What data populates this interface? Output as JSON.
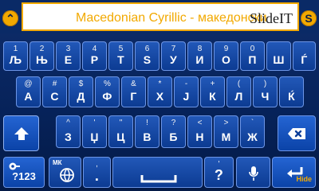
{
  "suggestion": {
    "text": "Macedonian Cyrillic - македонски",
    "brand": "SlideIT"
  },
  "side_buttons": {
    "left": "⌃",
    "right": "S"
  },
  "rows": {
    "row1": [
      {
        "alt": "1",
        "main": "Љ"
      },
      {
        "alt": "2",
        "main": "Њ"
      },
      {
        "alt": "3",
        "main": "Е"
      },
      {
        "alt": "4",
        "main": "Р"
      },
      {
        "alt": "5",
        "main": "Т"
      },
      {
        "alt": "6",
        "main": "Ѕ"
      },
      {
        "alt": "7",
        "main": "У"
      },
      {
        "alt": "8",
        "main": "И"
      },
      {
        "alt": "9",
        "main": "О"
      },
      {
        "alt": "0",
        "main": "П"
      },
      {
        "alt": "",
        "main": "Ш"
      },
      {
        "alt": "",
        "main": "Ѓ"
      }
    ],
    "row2": [
      {
        "alt": "@",
        "main": "А"
      },
      {
        "alt": "#",
        "main": "С"
      },
      {
        "alt": "$",
        "main": "Д"
      },
      {
        "alt": "%",
        "main": "Ф"
      },
      {
        "alt": "&",
        "main": "Г"
      },
      {
        "alt": "*",
        "main": "Х"
      },
      {
        "alt": "-",
        "main": "Ј"
      },
      {
        "alt": "+",
        "main": "К"
      },
      {
        "alt": "(",
        "main": "Л"
      },
      {
        "alt": ")",
        "main": "Ч"
      },
      {
        "alt": "",
        "main": "Ќ"
      }
    ],
    "row3": [
      {
        "alt": "^",
        "main": "З"
      },
      {
        "alt": "'",
        "main": "Џ"
      },
      {
        "alt": "\"",
        "main": "Ц"
      },
      {
        "alt": "!",
        "main": "В"
      },
      {
        "alt": "?",
        "main": "Б"
      },
      {
        "alt": "<",
        "main": "Н"
      },
      {
        "alt": ">",
        "main": "М"
      },
      {
        "alt": "`",
        "main": "Ж"
      }
    ]
  },
  "bottom": {
    "num_label": "?123",
    "language_code": "МК",
    "dot_alt": ",",
    "dot_main": ".",
    "dot2_alt": "'",
    "dot2_main": "?",
    "hide_label": "Hide"
  },
  "colors": {
    "accent": "#f2a900",
    "key": "#1a4fa9"
  }
}
